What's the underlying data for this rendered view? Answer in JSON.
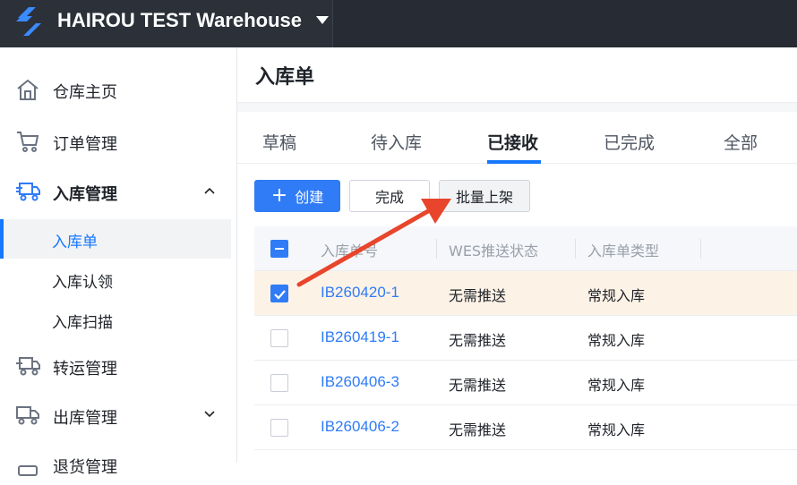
{
  "header": {
    "warehouse_name": "HAIROU TEST Warehouse",
    "logo_icon": "brand-logo-icon",
    "dropdown_icon": "caret-down-icon"
  },
  "sidebar": {
    "items": [
      {
        "label": "仓库主页",
        "icon": "home-icon"
      },
      {
        "label": "订单管理",
        "icon": "cart-icon"
      },
      {
        "label": "入库管理",
        "icon": "inbound-truck-icon",
        "expanded": true
      },
      {
        "label": "转运管理",
        "icon": "transfer-truck-icon"
      },
      {
        "label": "出库管理",
        "icon": "outbound-truck-icon",
        "expanded": false
      },
      {
        "label": "退货管理",
        "icon": "return-icon"
      }
    ],
    "inbound_sub": [
      {
        "label": "入库单",
        "selected": true
      },
      {
        "label": "入库认领"
      },
      {
        "label": "入库扫描"
      }
    ]
  },
  "page": {
    "title": "入库单"
  },
  "tabs": [
    {
      "label": "草稿"
    },
    {
      "label": "待入库"
    },
    {
      "label": "已接收",
      "active": true
    },
    {
      "label": "已完成"
    },
    {
      "label": "全部"
    }
  ],
  "toolbar": {
    "create_label": "创建",
    "complete_label": "完成",
    "batch_shelve_label": "批量上架"
  },
  "table": {
    "columns": [
      "入库单号",
      "WES推送状态",
      "入库单类型"
    ],
    "rows": [
      {
        "id": "IB260420-1",
        "wes_status": "无需推送",
        "type": "常规入库",
        "checked": true
      },
      {
        "id": "IB260419-1",
        "wes_status": "无需推送",
        "type": "常规入库",
        "checked": false
      },
      {
        "id": "IB260406-3",
        "wes_status": "无需推送",
        "type": "常规入库",
        "checked": false
      },
      {
        "id": "IB260406-2",
        "wes_status": "无需推送",
        "type": "常规入库",
        "checked": false
      }
    ]
  },
  "colors": {
    "accent": "#2f7cf6",
    "topbar": "#272b33",
    "selected_row": "#fdf2e6",
    "annotation_arrow": "#e8452c"
  }
}
